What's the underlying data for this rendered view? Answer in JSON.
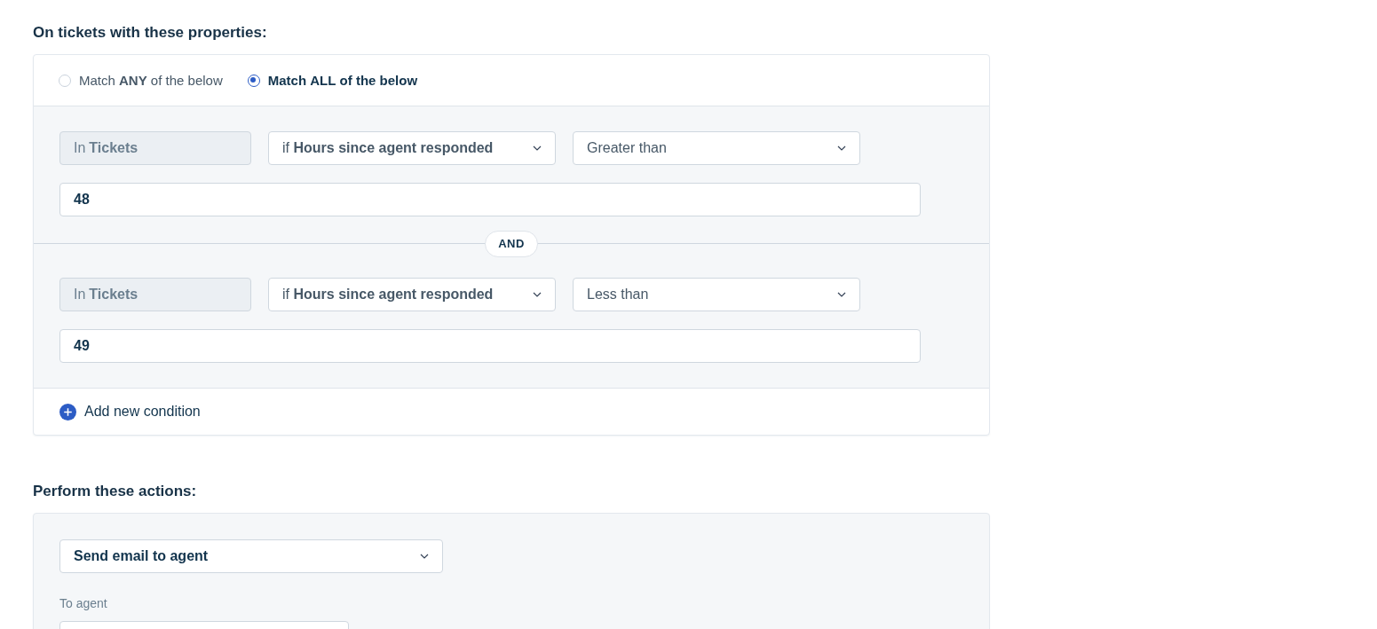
{
  "conditions_heading": "On tickets with these properties:",
  "match_options": [
    {
      "label": "Match **ANY** of the below",
      "selected": false
    },
    {
      "label": "Match **ALL** of the below",
      "selected": true
    }
  ],
  "conditions": [
    {
      "scope": "In **Tickets**",
      "field": "if **Hours since agent responded**",
      "operator": "Greater than",
      "value": "48"
    },
    {
      "scope": "In **Tickets**",
      "field": "if **Hours since agent responded**",
      "operator": "Less than",
      "value": "49"
    }
  ],
  "joiner": "AND",
  "add_condition": "Add new condition",
  "actions_heading": "Perform these actions:",
  "action": {
    "type": "Send email to agent",
    "recipient_label": "To agent"
  }
}
